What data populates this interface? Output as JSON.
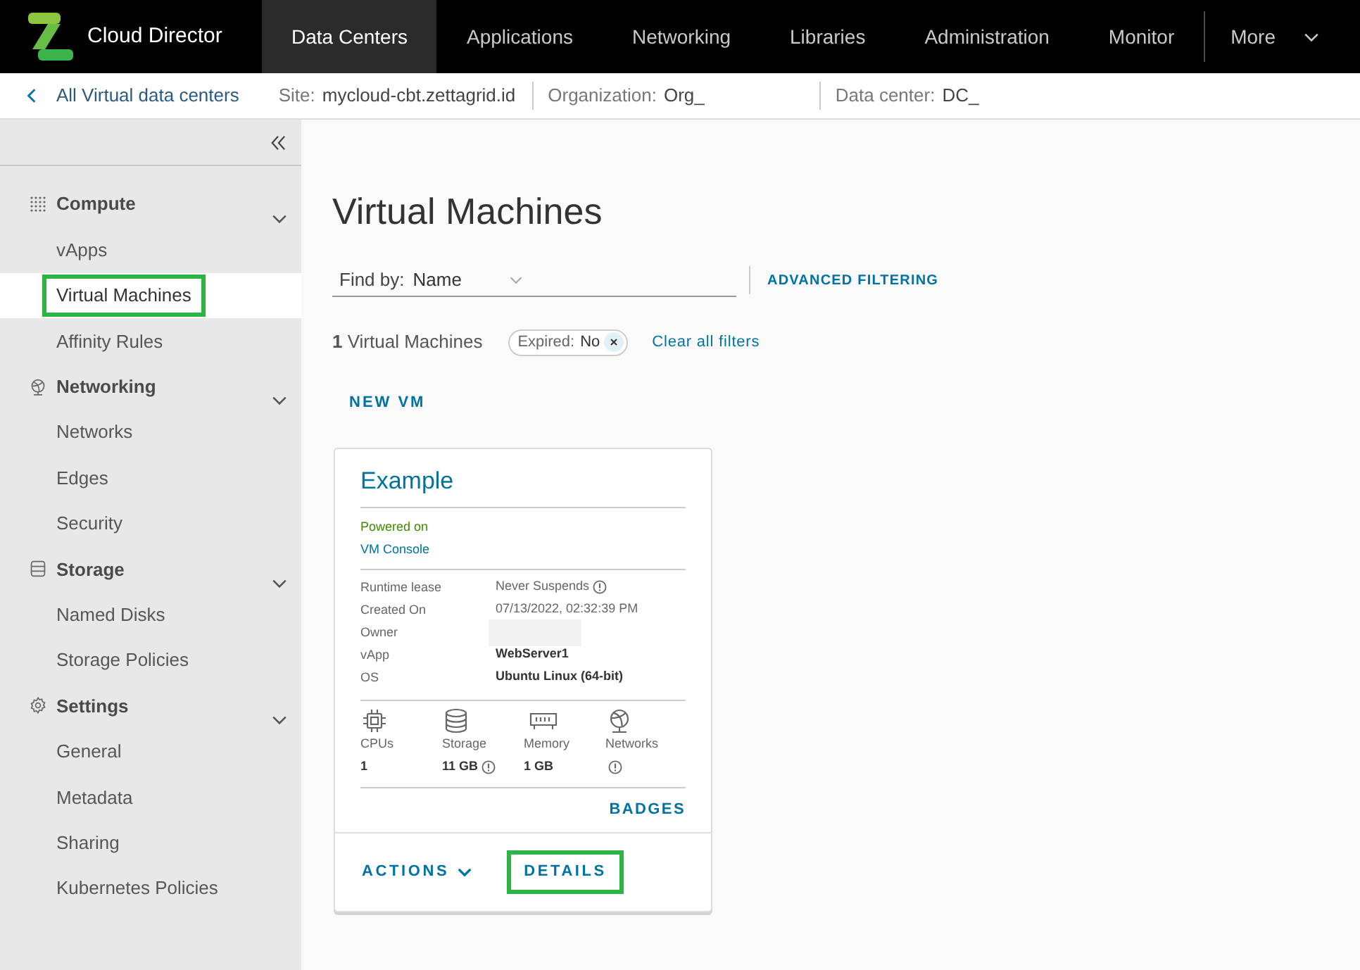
{
  "header": {
    "app_title": "Cloud Director",
    "nav_tabs": [
      {
        "label": "Data Centers",
        "selected": true
      },
      {
        "label": "Applications",
        "selected": false
      },
      {
        "label": "Networking",
        "selected": false
      },
      {
        "label": "Libraries",
        "selected": false
      },
      {
        "label": "Administration",
        "selected": false
      },
      {
        "label": "Monitor",
        "selected": false
      }
    ],
    "more_menu": "More"
  },
  "breadcrumb": {
    "back_link": "All Virtual data centers",
    "context": [
      {
        "label": "Site:",
        "value": "mycloud-cbt.zettagrid.id",
        "redacted": false
      },
      {
        "label": "Organization:",
        "value": "Org_",
        "redacted": true
      },
      {
        "label": "Data center:",
        "value": "DC_",
        "redacted": true
      }
    ]
  },
  "sidebar": {
    "groups": [
      {
        "kind": "compute",
        "label": "Compute",
        "expanded": true,
        "items": [
          {
            "label": "vApps",
            "selected": false,
            "highlighted": false
          },
          {
            "label": "Virtual Machines",
            "selected": true,
            "highlighted": true
          },
          {
            "label": "Affinity Rules",
            "selected": false,
            "highlighted": false
          }
        ]
      },
      {
        "kind": "networking",
        "label": "Networking",
        "expanded": true,
        "items": [
          {
            "label": "Networks",
            "selected": false,
            "highlighted": false
          },
          {
            "label": "Edges",
            "selected": false,
            "highlighted": false
          },
          {
            "label": "Security",
            "selected": false,
            "highlighted": false
          }
        ]
      },
      {
        "kind": "storage",
        "label": "Storage",
        "expanded": true,
        "items": [
          {
            "label": "Named Disks",
            "selected": false,
            "highlighted": false
          },
          {
            "label": "Storage Policies",
            "selected": false,
            "highlighted": false
          }
        ]
      },
      {
        "kind": "settings",
        "label": "Settings",
        "expanded": true,
        "items": [
          {
            "label": "General",
            "selected": false,
            "highlighted": false
          },
          {
            "label": "Metadata",
            "selected": false,
            "highlighted": false
          },
          {
            "label": "Sharing",
            "selected": false,
            "highlighted": false
          },
          {
            "label": "Kubernetes Policies",
            "selected": false,
            "highlighted": false
          }
        ]
      }
    ]
  },
  "main": {
    "title": "Virtual Machines",
    "search": {
      "label": "Find by:",
      "value": "Name"
    },
    "advanced_filtering": "ADVANCED FILTERING",
    "result_count": "**1** Virtual Machines",
    "filter_chips": [
      {
        "label": "Expired:",
        "value": "No"
      }
    ],
    "clear_filters": "Clear all filters",
    "new_vm": "NEW VM",
    "vm_cards": [
      {
        "name": "Example",
        "power_state": {
          "label": "Powered on",
          "on": true
        },
        "console_link": "VM Console",
        "details": [
          {
            "label": "Runtime lease",
            "value": "Never Suspends",
            "info": true,
            "strong": false,
            "redacted": false
          },
          {
            "label": "Created On",
            "value": "07/13/2022, 02:32:39 PM",
            "info": false,
            "strong": false,
            "redacted": false
          },
          {
            "label": "Owner",
            "redacted": true
          },
          {
            "label": "vApp",
            "value": "WebServer1",
            "info": false,
            "strong": true,
            "redacted": false
          },
          {
            "label": "OS",
            "value": "Ubuntu Linux (64-bit)",
            "info": false,
            "strong": true,
            "redacted": false
          }
        ],
        "resources": [
          {
            "kind": "cpu",
            "label": "CPUs",
            "value": "1",
            "info": false
          },
          {
            "kind": "storage",
            "label": "Storage",
            "value": "11 GB",
            "info": true
          },
          {
            "kind": "memory",
            "label": "Memory",
            "value": "1 GB",
            "info": false
          },
          {
            "kind": "network",
            "label": "Networks",
            "info": true
          }
        ],
        "badges": "BADGES",
        "actions": "ACTIONS",
        "details_button": {
          "label": "DETAILS",
          "highlighted": true
        }
      }
    ]
  }
}
